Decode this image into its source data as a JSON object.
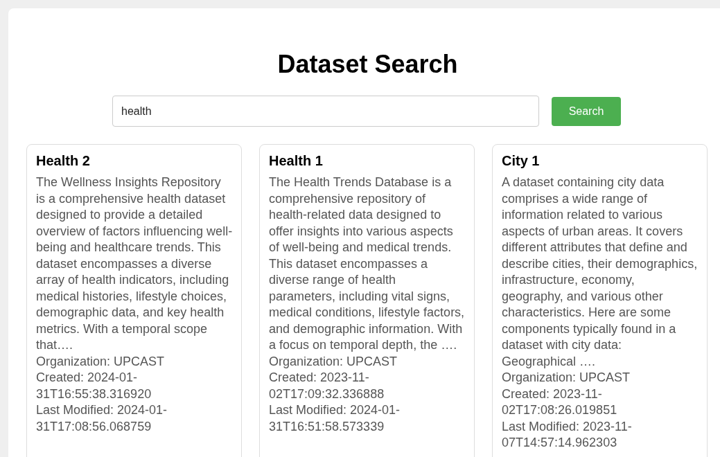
{
  "title": "Dataset Search",
  "search": {
    "value": "health",
    "button": "Search"
  },
  "results": [
    {
      "name": "Health 2",
      "description": "The Wellness Insights Repository is a comprehensive health dataset designed to provide a detailed overview of factors influencing well-being and healthcare trends. This dataset encompasses a diverse array of health indicators, including medical histories, lifestyle choices, demographic data, and key health metrics. With a temporal scope that….",
      "organization": "Organization: UPCAST",
      "created": "Created: 2024-01-31T16:55:38.316920",
      "modified": "Last Modified: 2024-01-31T17:08:56.068759"
    },
    {
      "name": "Health 1",
      "description": "The Health Trends Database is a comprehensive repository of health-related data designed to offer insights into various aspects of well-being and medical trends. This dataset encompasses a diverse range of health parameters, including vital signs, medical conditions, lifestyle factors, and demographic information. With a focus on temporal depth, the ….",
      "organization": "Organization: UPCAST",
      "created": "Created: 2023-11-02T17:09:32.336888",
      "modified": "Last Modified: 2024-01-31T16:51:58.573339"
    },
    {
      "name": "City 1",
      "description": "A dataset containing city data comprises a wide range of information related to various aspects of urban areas. It covers different attributes that define and describe cities, their demographics, infrastructure, economy, geography, and various other characteristics. Here are some components typically found in a dataset with city data: Geographical ….",
      "organization": "Organization: UPCAST",
      "created": "Created: 2023-11-02T17:08:26.019851",
      "modified": "Last Modified: 2023-11-07T14:57:14.962303"
    }
  ]
}
